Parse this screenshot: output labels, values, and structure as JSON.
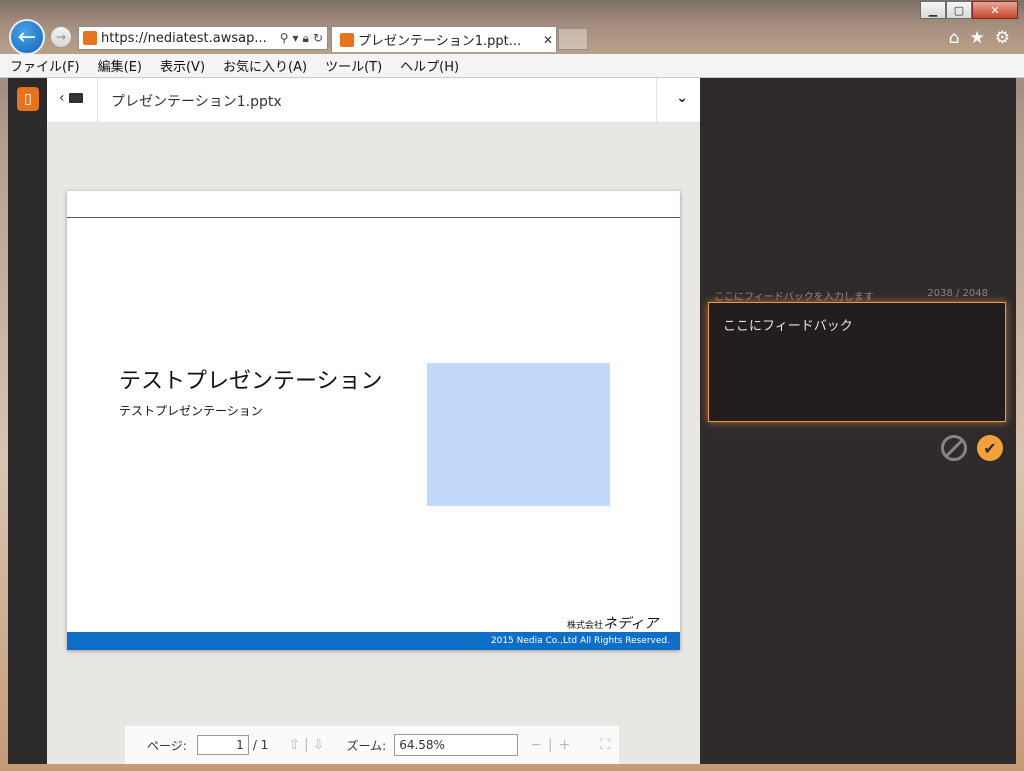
{
  "browser": {
    "address": "https://nediatest.awsap...",
    "tab_title": "プレゼンテーション1.ppt..."
  },
  "menu": {
    "items": [
      "ファイル(F)",
      "編集(E)",
      "表示(V)",
      "お気に入り(A)",
      "ツール(T)",
      "ヘルプ(H)"
    ]
  },
  "document": {
    "name": "プレゼンテーション1.pptx"
  },
  "slide": {
    "title": "テストプレゼンテーション",
    "subtitle": "テストプレゼンテーション",
    "logo_prefix": "株式会社",
    "logo_name": "ネディア",
    "footer": "2015 Nedia Co.,Ltd All Rights Reserved."
  },
  "pagebar": {
    "page_label": "ページ:",
    "page_value": "1",
    "page_total": "/ 1",
    "zoom_label": "ズーム:",
    "zoom_value": "64.58%"
  },
  "feedback": {
    "placeholder_label": "ここにフィードバックを入力します",
    "counter": "2038 / 2048",
    "text": "ここにフィードバック"
  },
  "colors": {
    "accent": "#f2a13a",
    "slide_footer": "#0f6fc6",
    "slide_rect": "#c2d9fb"
  }
}
